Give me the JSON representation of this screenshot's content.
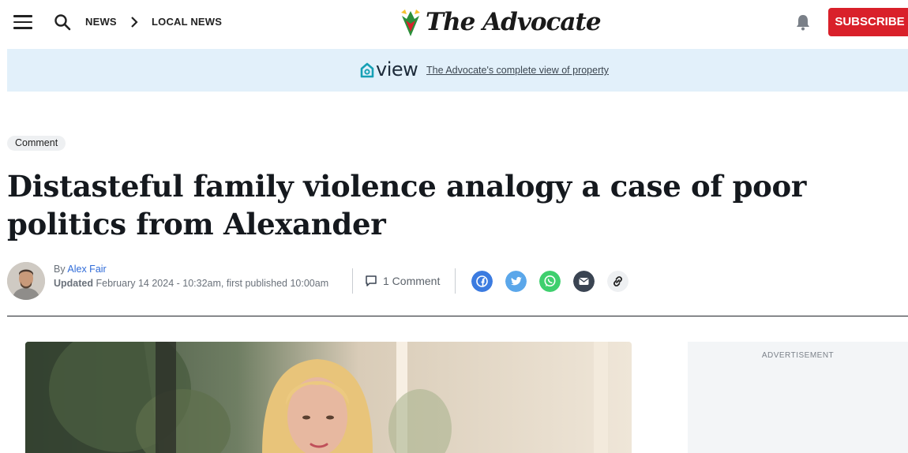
{
  "header": {
    "breadcrumb": [
      "NEWS",
      "LOCAL NEWS"
    ],
    "logo_text": "The Advocate",
    "subscribe_label": "SUBSCRIBE"
  },
  "banner": {
    "logo_word": "view",
    "link_text": "The Advocate's complete view of property"
  },
  "article": {
    "tag": "Comment",
    "headline": "Distasteful family violence analogy a case of poor politics from Alexander",
    "byline_prefix": "By",
    "author": "Alex Fair",
    "updated_label": "Updated",
    "updated_text": "February 14 2024 - 10:32am, first published 10:00am",
    "comments_label": "1 Comment",
    "share_icons": [
      "facebook-icon",
      "twitter-icon",
      "whatsapp-icon",
      "email-icon",
      "link-icon"
    ]
  },
  "sidebar": {
    "ad_label": "ADVERTISEMENT"
  },
  "colors": {
    "subscribe": "#d9202a",
    "banner_bg": "#e2f0fa",
    "facebook": "#3b7be0",
    "twitter": "#5ba7ea",
    "whatsapp": "#3fcf6e",
    "email": "#3a4452",
    "link_bg": "#eef0f2",
    "author_link": "#2f6bd8"
  }
}
